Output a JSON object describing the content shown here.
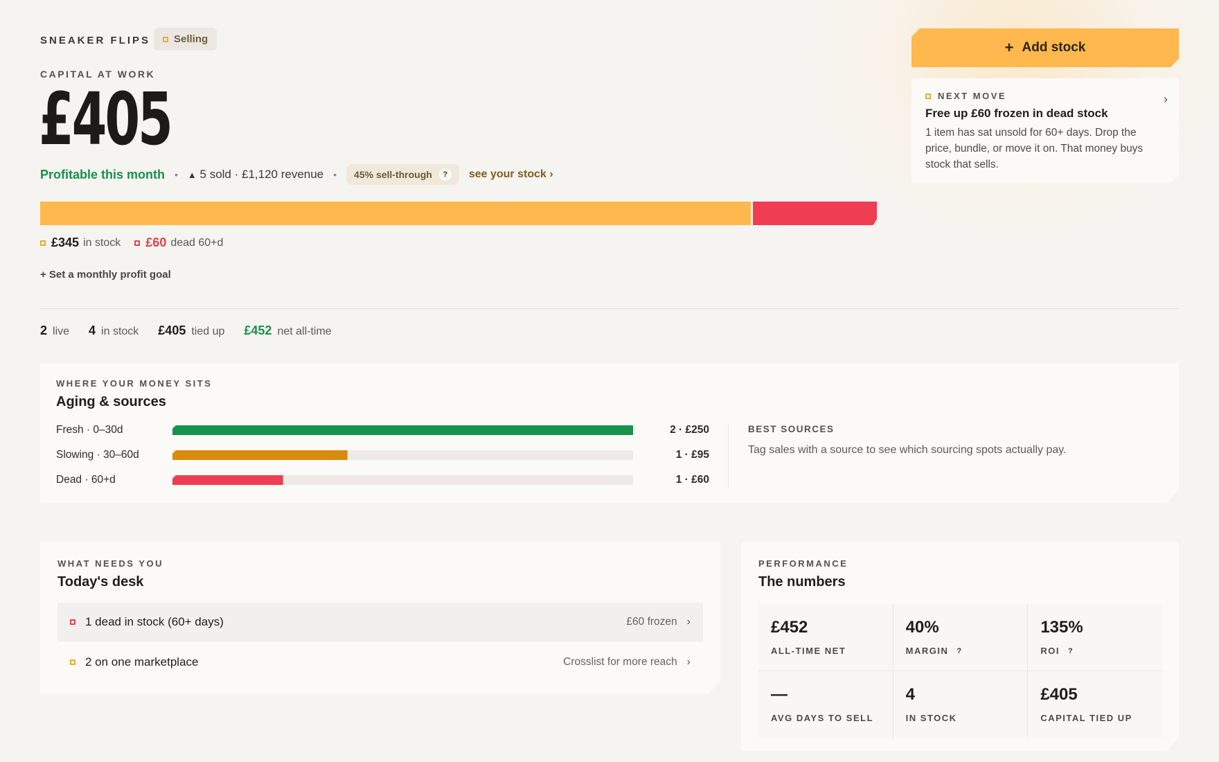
{
  "header": {
    "brand": "SNEAKER FLIPS",
    "status_pill": "Selling",
    "capital_label": "CAPITAL AT WORK",
    "capital_value": "£405"
  },
  "status": {
    "profit_text": "Profitable this month",
    "sold_summary": "5 sold · £1,120 revenue",
    "sell_through": "45% sell-through",
    "help": "?",
    "see_stock": "see your stock ›"
  },
  "capital_bar": {
    "in_stock_value": "£345",
    "in_stock_label": "in stock",
    "dead_value": "£60",
    "dead_label": "dead 60+d",
    "in_stock_amount": 345,
    "dead_amount": 60,
    "colors": {
      "in_stock": "#ffb84e",
      "dead": "#ef3d52"
    }
  },
  "goal_link": "+ Set a monthly profit goal",
  "stats": [
    {
      "value": "2",
      "label": "live"
    },
    {
      "value": "4",
      "label": "in stock"
    },
    {
      "value": "£405",
      "label": "tied up"
    },
    {
      "value": "£452",
      "label": "net all-time"
    }
  ],
  "actions": {
    "add_stock": "Add stock",
    "add_icon": "+"
  },
  "next_move": {
    "eyebrow": "NEXT MOVE",
    "title": "Free up £60 frozen in dead stock",
    "body": "1 item has sat unsold for 60+ days. Drop the price, bundle, or move it on. That money buys stock that sells.",
    "chevron": "›"
  },
  "aging": {
    "eyebrow": "WHERE YOUR MONEY SITS",
    "title": "Aging & sources",
    "rows": [
      {
        "label": "Fresh · 0–30d",
        "value": "2 · £250",
        "amount": 250,
        "color": "#15924c"
      },
      {
        "label": "Slowing · 30–60d",
        "value": "1 · £95",
        "amount": 95,
        "color": "#d98b0c"
      },
      {
        "label": "Dead · 60+d",
        "value": "1 · £60",
        "amount": 60,
        "color": "#ef3d52"
      }
    ],
    "scale_max": 250,
    "best_sources_title": "BEST SOURCES",
    "best_sources_body": "Tag sales with a source to see which sourcing spots actually pay."
  },
  "desk": {
    "eyebrow": "WHAT NEEDS YOU",
    "title": "Today's desk",
    "items": [
      {
        "text": "1 dead in stock (60+ days)",
        "sub": "£60 frozen",
        "chevron": "›"
      },
      {
        "text": "2 on one marketplace",
        "sub": "Crosslist for more reach",
        "chevron": "›"
      }
    ]
  },
  "performance": {
    "eyebrow": "PERFORMANCE",
    "title": "The numbers",
    "cells": [
      {
        "value": "£452",
        "label": "ALL-TIME NET",
        "help": ""
      },
      {
        "value": "40%",
        "label": "MARGIN",
        "help": "?"
      },
      {
        "value": "135%",
        "label": "ROI",
        "help": "?"
      },
      {
        "value": "—",
        "label": "AVG DAYS TO SELL",
        "help": ""
      },
      {
        "value": "4",
        "label": "IN STOCK",
        "help": ""
      },
      {
        "value": "£405",
        "label": "CAPITAL TIED UP",
        "help": ""
      }
    ]
  }
}
